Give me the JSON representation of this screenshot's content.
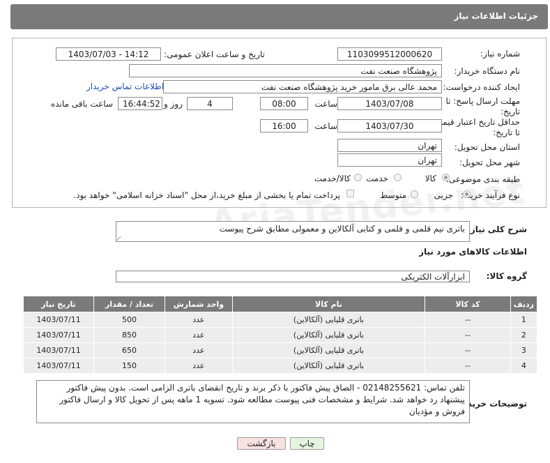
{
  "header": {
    "title": "جزئیات اطلاعات نیاز"
  },
  "form": {
    "need_number_label": "شماره نیاز:",
    "need_number": "1103099512000620",
    "announce_label": "تاریخ و ساعت اعلان عمومی:",
    "announce_value": "1403/07/03 - 14:12",
    "buyer_org_label": "نام دستگاه خریدار:",
    "buyer_org": "پژوهشگاه صنعت نفت",
    "creator_label": "ایجاد کننده درخواست:",
    "creator": "محمد عالی برق مامور خرید پژوهشگاه صنعت نفت",
    "contact_link": "اطلاعات تماس خریدار",
    "deadline_label": "مهلت ارسال پاسخ: تا تاریخ:",
    "deadline_date": "1403/07/08",
    "time_label": "ساعت",
    "deadline_time": "08:00",
    "days_value": "4",
    "days_label": "روز و",
    "remaining_time": "16:44:52",
    "remaining_label": "ساعت باقی مانده",
    "validity_label": "حداقل تاریخ اعتبار قیمت: تا تاریخ:",
    "validity_date": "1403/07/30",
    "validity_time_label": "ساعت",
    "validity_time": "16:00",
    "province_label": "استان محل تحویل:",
    "province": "تهران",
    "city_label": "شهر محل تحویل:",
    "city": "تهران",
    "category_label": "طبقه بندی موضوعی:",
    "category_options": [
      "کالا",
      "خدمت",
      "کالا/خدمت"
    ],
    "category_selected": 0,
    "purchase_label": "نوع فرآیند خرید :",
    "purchase_options": [
      "جزیی",
      "متوسط"
    ],
    "purchase_selected": 0,
    "payment_note": "پرداخت تمام یا بخشی از مبلغ خرید،از محل \"اسناد خزانه اسلامی\" خواهد بود."
  },
  "description": {
    "label": "شرح کلی نیاز:",
    "text": "باتری نیم قلمی و قلمی و کتابی آلکالاین و معمولی مطابق شرح پیوست"
  },
  "goods": {
    "section_title": "اطلاعات کالاهای مورد نیاز",
    "group_label": "گروه کالا:",
    "group_value": "ابزارآلات الکتریکی",
    "columns": [
      "ردیف",
      "کد کالا",
      "نام کالا",
      "واحد شمارش",
      "تعداد / مقدار",
      "تاریخ نیاز"
    ],
    "rows": [
      {
        "n": "1",
        "code": "--",
        "name": "باتری قلیایی (آلکالاین)",
        "unit": "عدد",
        "qty": "500",
        "date": "1403/07/11"
      },
      {
        "n": "2",
        "code": "--",
        "name": "باتری قلیایی (آلکالاین)",
        "unit": "عدد",
        "qty": "850",
        "date": "1403/07/11"
      },
      {
        "n": "3",
        "code": "--",
        "name": "باتری قلیایی (آلکالاین)",
        "unit": "عدد",
        "qty": "650",
        "date": "1403/07/11"
      },
      {
        "n": "4",
        "code": "--",
        "name": "باتری قلیایی (آلکالاین)",
        "unit": "عدد",
        "qty": "150",
        "date": "1403/07/11"
      }
    ]
  },
  "buyer_notes": {
    "label": "توضیحات خریدار:",
    "text": "تلفن تماس: 02148255621 - الصاق پیش فاکتور با ذکر برند و تاریخ انقضای باتری الزامی است. بدون پیش فاکتور پیشنهاد رد خواهد شد. شرایط و مشخصات فنی پیوست مطالعه شود. تسویه 1 ماهه پس از تحویل کالا و ارسال فاکتور فروش و مؤدیان"
  },
  "buttons": {
    "print": "چاپ",
    "back": "بازگشت"
  },
  "watermark": "AriaTender.net",
  "colors": {
    "header_bg": "#7a7a7a",
    "print_bg": "#e6f5e0",
    "back_bg": "#f8e1e1",
    "link": "#1a4fb5"
  }
}
